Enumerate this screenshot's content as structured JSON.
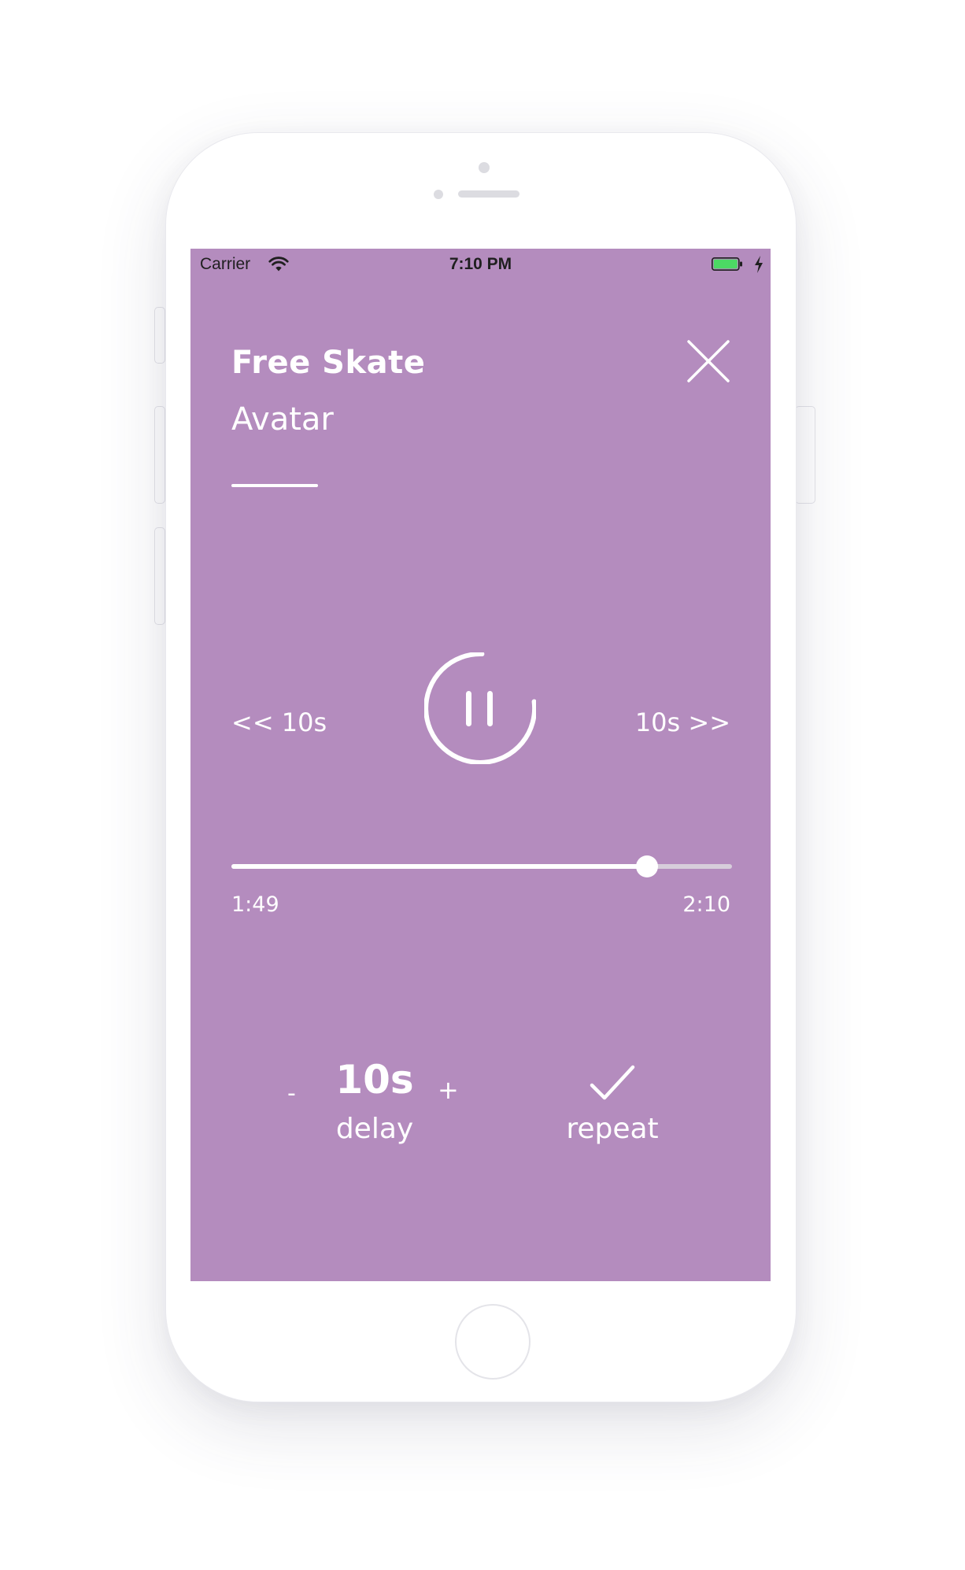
{
  "status_bar": {
    "carrier": "Carrier",
    "time": "7:10 PM",
    "wifi_icon": "wifi-icon",
    "battery_icon": "battery-charging-icon"
  },
  "player": {
    "title": "Free Skate",
    "subtitle": "Avatar",
    "close_icon": "close-icon",
    "rewind_label": "<< 10s",
    "forward_label": "10s >>",
    "pause_icon": "pause-icon",
    "progress_fraction": 0.83,
    "elapsed": "1:49",
    "total": "2:10"
  },
  "controls": {
    "minus_label": "-",
    "delay_value": "10s",
    "delay_label": "delay",
    "plus_label": "+",
    "repeat_icon": "checkmark-icon",
    "repeat_label": "repeat"
  },
  "colors": {
    "screen_background": "#b48cbe",
    "foreground": "#ffffff",
    "battery_fill": "#4cd964"
  }
}
